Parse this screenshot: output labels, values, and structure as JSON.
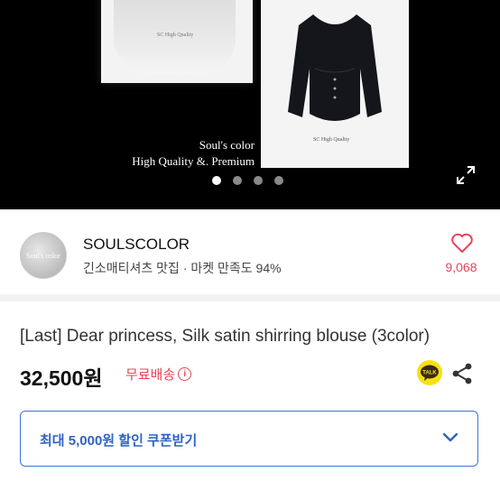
{
  "hero": {
    "slogan_line1": "Soul's color",
    "slogan_line2": "High Quality  &. Premium",
    "card_left_tag": "SC High Quality",
    "card_right_tag": "SC High Quality",
    "dots_count": 4,
    "active_dot": 0,
    "expand_icon": "expand-icon"
  },
  "seller": {
    "avatar_text": "Soul's color",
    "name": "SOULSCOLOR",
    "description": "긴소매티셔츠 맛집 · 마켓 만족도 94%",
    "like_count": "9,068",
    "heart_icon": "heart-icon"
  },
  "product": {
    "title": "[Last] Dear princess, Silk satin shirring blouse (3color)",
    "price": "32,500원",
    "shipping": "무료배송",
    "talk_label": "TALK"
  },
  "coupon": {
    "label": "최대 5,000원 할인 쿠폰받기"
  },
  "colors": {
    "accent_red": "#e8445a",
    "coupon_blue": "#3d74d9"
  }
}
